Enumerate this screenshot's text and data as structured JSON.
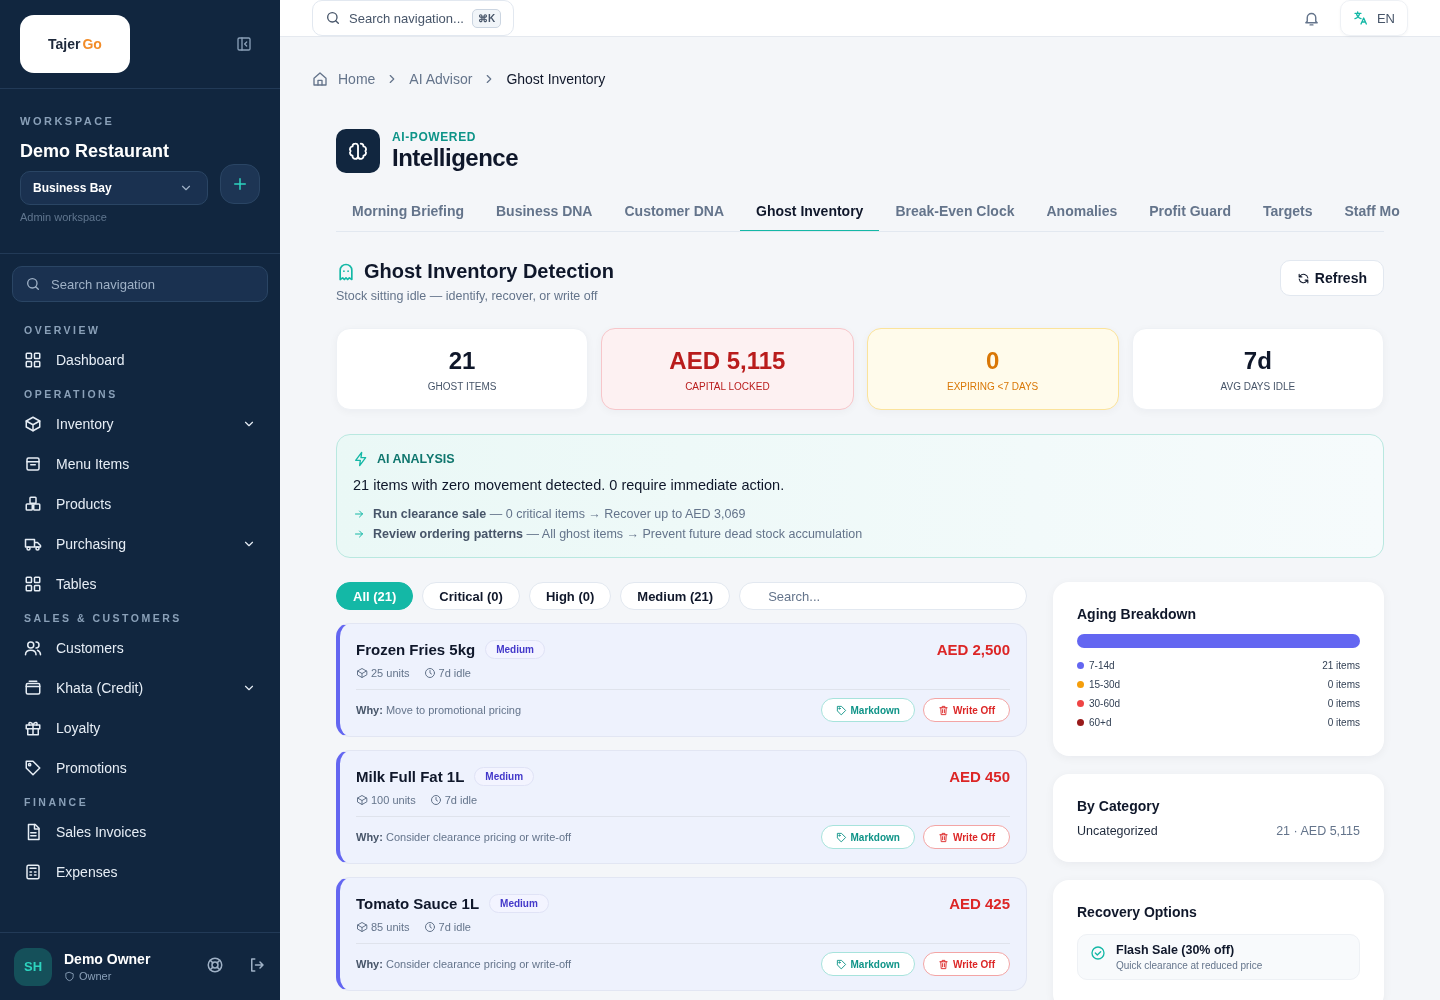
{
  "sidebar": {
    "logo": {
      "text": "Tajer",
      "accent": "Go"
    },
    "workspace_label": "WORKSPACE",
    "workspace_name": "Demo Restaurant",
    "branch": "Business Bay",
    "workspace_note": "Admin workspace",
    "search_placeholder": "Search navigation",
    "sections": [
      {
        "title": "OVERVIEW",
        "items": [
          {
            "label": "Dashboard",
            "expandable": false
          }
        ]
      },
      {
        "title": "OPERATIONS",
        "items": [
          {
            "label": "Inventory",
            "expandable": true
          },
          {
            "label": "Menu Items",
            "expandable": false
          },
          {
            "label": "Products",
            "expandable": false
          },
          {
            "label": "Purchasing",
            "expandable": true
          },
          {
            "label": "Tables",
            "expandable": false
          }
        ]
      },
      {
        "title": "SALES & CUSTOMERS",
        "items": [
          {
            "label": "Customers",
            "expandable": false
          },
          {
            "label": "Khata (Credit)",
            "expandable": true
          },
          {
            "label": "Loyalty",
            "expandable": false
          },
          {
            "label": "Promotions",
            "expandable": false
          }
        ]
      },
      {
        "title": "FINANCE",
        "items": [
          {
            "label": "Sales Invoices",
            "expandable": false
          },
          {
            "label": "Expenses",
            "expandable": false
          }
        ]
      }
    ],
    "user": {
      "initials": "SH",
      "name": "Demo Owner",
      "role": "Owner"
    }
  },
  "topbar": {
    "search_placeholder": "Search navigation...",
    "shortcut": "⌘K",
    "language": "EN"
  },
  "breadcrumb": [
    "Home",
    "AI Advisor",
    "Ghost Inventory"
  ],
  "header": {
    "eyebrow": "AI-POWERED",
    "title": "Intelligence"
  },
  "tabs": [
    {
      "label": "Morning Briefing",
      "selected": false
    },
    {
      "label": "Business DNA",
      "selected": false
    },
    {
      "label": "Customer DNA",
      "selected": false
    },
    {
      "label": "Ghost Inventory",
      "selected": true
    },
    {
      "label": "Break-Even Clock",
      "selected": false
    },
    {
      "label": "Anomalies",
      "selected": false
    },
    {
      "label": "Profit Guard",
      "selected": false
    },
    {
      "label": "Targets",
      "selected": false
    },
    {
      "label": "Staff Mo",
      "selected": false
    }
  ],
  "section": {
    "title": "Ghost Inventory Detection",
    "subtitle": "Stock sitting idle — identify, recover, or write off",
    "refresh": "Refresh"
  },
  "stats": [
    {
      "value": "21",
      "label": "GHOST ITEMS",
      "kind": "neutral"
    },
    {
      "value": "AED 5,115",
      "label": "CAPITAL LOCKED",
      "kind": "danger"
    },
    {
      "value": "0",
      "label": "EXPIRING <7 DAYS",
      "kind": "warning"
    },
    {
      "value": "7d",
      "label": "AVG DAYS IDLE",
      "kind": "neutral"
    }
  ],
  "analysis": {
    "title": "AI ANALYSIS",
    "summary": "21 items with zero movement detected. 0 require immediate action.",
    "actions": [
      "**Run clearance sale** — 0 critical items → Recover up to AED 3,069",
      "**Review ordering patterns** — All ghost items → Prevent future dead stock accumulation"
    ]
  },
  "filters": [
    {
      "label": "All (21)",
      "selected": true
    },
    {
      "label": "Critical (0)",
      "selected": false
    },
    {
      "label": "High (0)",
      "selected": false
    },
    {
      "label": "Medium (21)",
      "selected": false
    }
  ],
  "filter_search_placeholder": "Search...",
  "items": [
    {
      "name": "Frozen Fries 5kg",
      "severity": "Medium",
      "units": "25 units",
      "idle": "7d idle",
      "value": "AED 2,500",
      "why": "**Why:** Move to promotional pricing",
      "actions": [
        "Markdown",
        "Write Off"
      ]
    },
    {
      "name": "Milk Full Fat 1L",
      "severity": "Medium",
      "units": "100 units",
      "idle": "7d idle",
      "value": "AED 450",
      "why": "**Why:** Consider clearance pricing or write-off",
      "actions": [
        "Markdown",
        "Write Off"
      ]
    },
    {
      "name": "Tomato Sauce 1L",
      "severity": "Medium",
      "units": "85 units",
      "idle": "7d idle",
      "value": "AED 425",
      "why": "**Why:** Consider clearance pricing or write-off",
      "actions": [
        "Markdown",
        "Write Off"
      ]
    }
  ],
  "aging": {
    "title": "Aging Breakdown",
    "buckets": [
      {
        "label": "7-14d",
        "count": "21 items",
        "color": "#6366f1",
        "level": 1
      },
      {
        "label": "15-30d",
        "count": "0 items",
        "color": "#f59e0b",
        "level": 0
      },
      {
        "label": "30-60d",
        "count": "0 items",
        "color": "#ef4444",
        "level": 0
      },
      {
        "label": "60+d",
        "count": "0 items",
        "color": "#991b1b",
        "level": 0
      }
    ]
  },
  "by_category": {
    "title": "By Category",
    "rows": [
      {
        "name": "Uncategorized",
        "value": "21 · AED 5,115"
      }
    ]
  },
  "recovery": {
    "title": "Recovery Options",
    "options": [
      {
        "title": "Flash Sale (30% off)",
        "note": "Quick clearance at reduced price"
      }
    ]
  }
}
